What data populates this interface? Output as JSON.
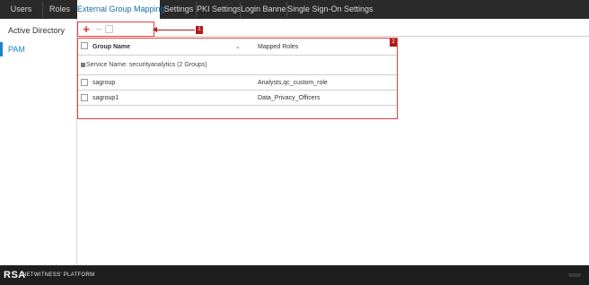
{
  "tabs": [
    {
      "label": "Users"
    },
    {
      "label": "Roles"
    },
    {
      "label": "External Group Mapping"
    },
    {
      "label": "Settings"
    },
    {
      "label": "PKI Settings"
    },
    {
      "label": "Login Banner"
    },
    {
      "label": "Single Sign-On Settings"
    }
  ],
  "active_tab": "External Group Mapping",
  "sidebar": {
    "items": [
      {
        "label": "Active Directory"
      },
      {
        "label": "PAM"
      }
    ],
    "active_item": "PAM"
  },
  "toolbar": {
    "add_icon": "plus-icon",
    "remove_icon": "minus-icon",
    "edit_icon": "edit-icon",
    "add_glyph": "+",
    "remove_glyph": "−",
    "callout_number": "1"
  },
  "table": {
    "callout_number": "2",
    "columns": [
      "Group Name",
      "Mapped Roles"
    ],
    "group_header": "Service Name: securityanalytics (2 Groups)",
    "rows": [
      {
        "group_name": "sagroup",
        "mapped_roles": "Analysts,qc_custom_role"
      },
      {
        "group_name": "sagroup1",
        "mapped_roles": "Data_Privacy_Officers"
      }
    ]
  },
  "footer": {
    "brand": "RSA",
    "product": "NETWITNESS' PLATFORM"
  },
  "colors": {
    "accent": "#1a85c8",
    "callout": "#b01c1c",
    "add": "#e02a2a",
    "topbar": "#2a2a2a",
    "footer": "#1e1e1e"
  }
}
